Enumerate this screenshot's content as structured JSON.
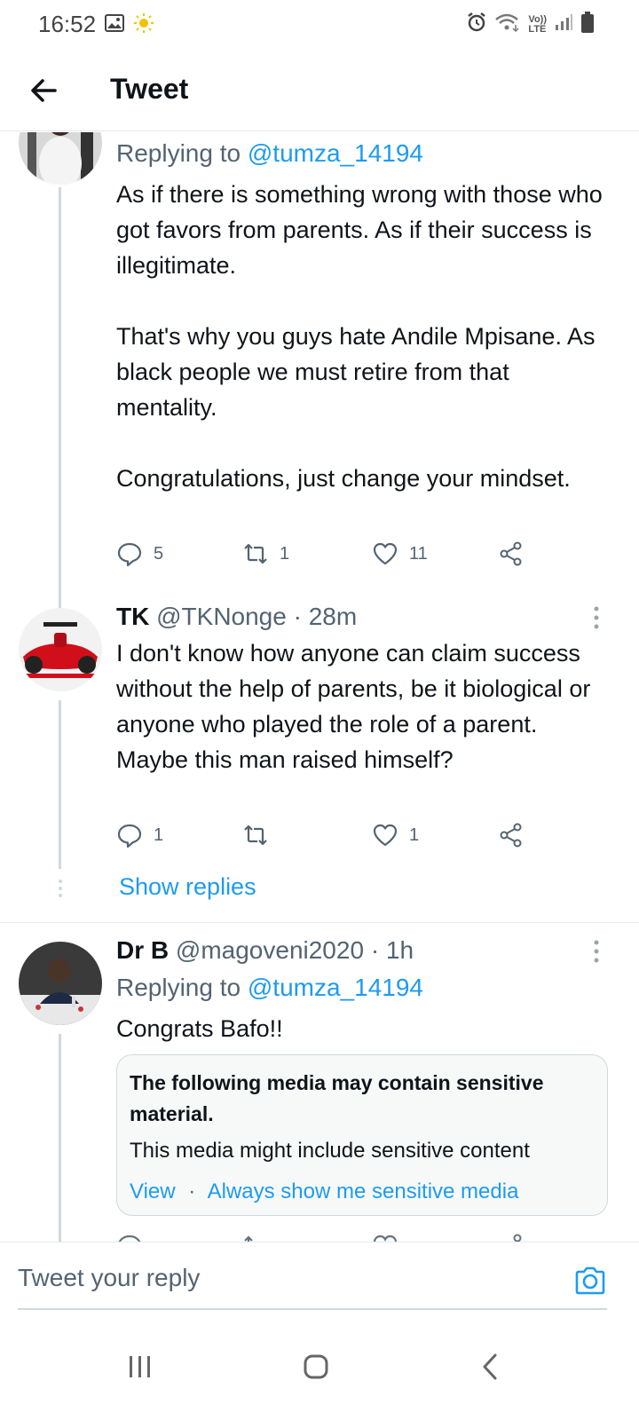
{
  "status_bar": {
    "time": "16:52",
    "left_icons": [
      "image-icon",
      "sun-icon"
    ],
    "right_icons": [
      "alarm-icon",
      "wifi-icon",
      "volte-icon",
      "signal-icon",
      "battery-icon"
    ],
    "volte_label_top": "Vo))",
    "volte_label_bottom": "LTE"
  },
  "header": {
    "title": "Tweet",
    "back_icon": "arrow-left-icon"
  },
  "tweets": [
    {
      "replying_prefix": "Replying to",
      "replying_handle": "@tumza_14194",
      "text": "As if there is something wrong with those who got favors from parents. As if their success is illegitimate.\n\nThat's why you guys hate Andile Mpisane. As black people we must retire from that mentality.\n\nCongratulations, just change your mindset.",
      "replies": "5",
      "retweets": "1",
      "likes": "11"
    },
    {
      "name": "TK",
      "handle": "@TKNonge",
      "separator": "·",
      "time": "28m",
      "text": "I don't know how anyone can claim success without the help of parents, be it biological or anyone who played the role of a parent. Maybe this man raised himself?",
      "replies": "1",
      "retweets": "",
      "likes": "1",
      "show_replies": "Show replies"
    },
    {
      "name": "Dr B",
      "handle": "@magoveni2020",
      "separator": "·",
      "time": "1h",
      "replying_prefix": "Replying to",
      "replying_handle": "@tumza_14194",
      "text": "Congrats Bafo!!",
      "sensitive": {
        "title": "The following media may contain sensitive material.",
        "body": "This media might include sensitive content",
        "view": "View",
        "dot": "·",
        "always_show": "Always show me sensitive media"
      }
    }
  ],
  "composer": {
    "placeholder": "Tweet your reply",
    "camera_icon": "camera-icon"
  },
  "colors": {
    "accent": "#1d9bf0",
    "text": "#0f1419",
    "secondary": "#536471",
    "border": "#cfd9de"
  }
}
